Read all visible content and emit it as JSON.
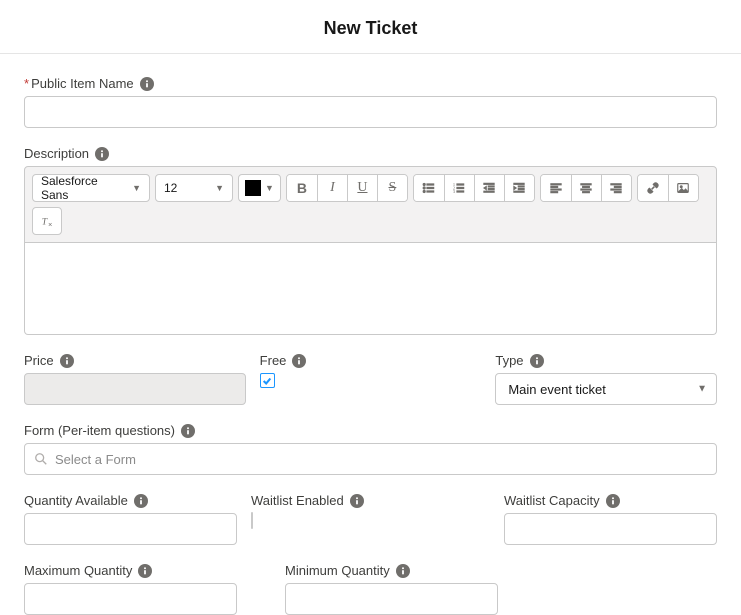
{
  "header": {
    "title": "New Ticket"
  },
  "fields": {
    "publicItemName": {
      "label": "Public Item Name",
      "required": true,
      "value": ""
    },
    "description": {
      "label": "Description"
    },
    "price": {
      "label": "Price",
      "value": ""
    },
    "free": {
      "label": "Free",
      "checked": true
    },
    "type": {
      "label": "Type",
      "value": "Main event ticket"
    },
    "form": {
      "label": "Form (Per-item questions)",
      "placeholder": "Select a Form"
    },
    "quantityAvailable": {
      "label": "Quantity Available",
      "value": ""
    },
    "waitlistEnabled": {
      "label": "Waitlist Enabled",
      "checked": false
    },
    "waitlistCapacity": {
      "label": "Waitlist Capacity",
      "value": ""
    },
    "maximumQuantity": {
      "label": "Maximum Quantity",
      "value": ""
    },
    "minimumQuantity": {
      "label": "Minimum Quantity",
      "value": ""
    }
  },
  "editor": {
    "font": "Salesforce Sans",
    "size": "12"
  }
}
